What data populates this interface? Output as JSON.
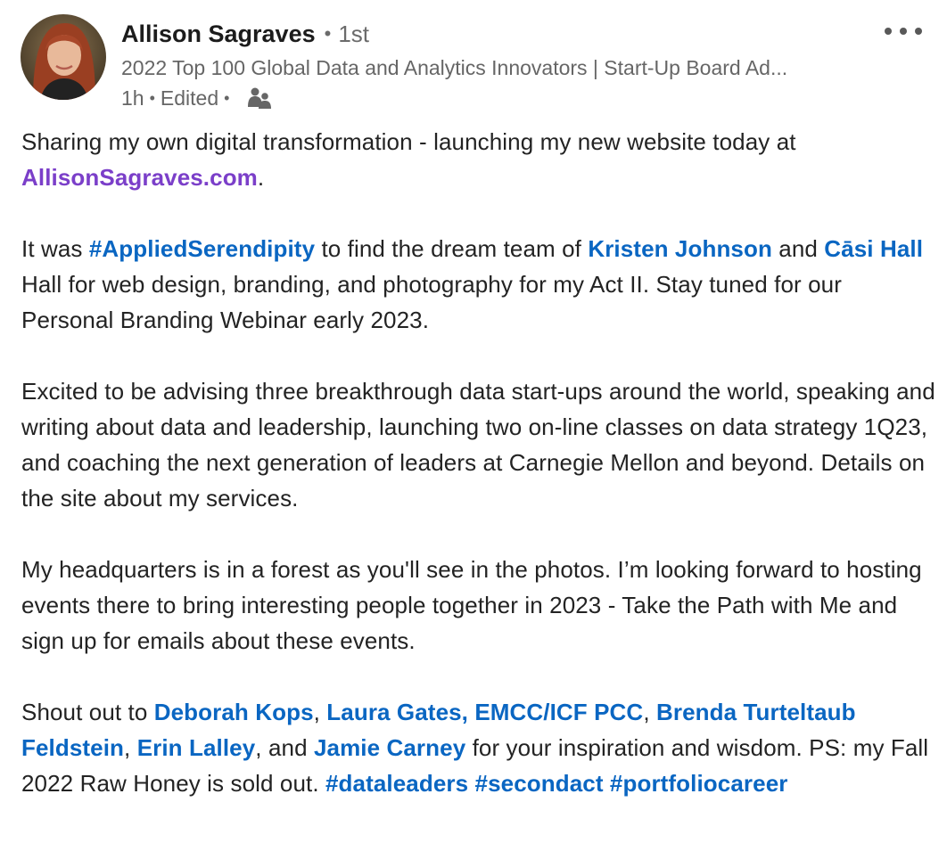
{
  "author": {
    "name": "Allison Sagraves",
    "bullet": "•",
    "degree": "1st",
    "headline": "2022 Top 100 Global Data and Analytics Innovators | Start-Up Board Ad...",
    "time": "1h",
    "separator": "•",
    "edited": "Edited",
    "visibility_icon": "connections-icon"
  },
  "post": {
    "p1_a": "Sharing my own digital transformation - launching my new website today at ",
    "p1_link": "AllisonSagraves.com",
    "p1_b": ".",
    "p2_a": "It was ",
    "p2_tag": "#AppliedSerendipity",
    "p2_b": " to find the dream team of ",
    "p2_m1": "Kristen Johnson",
    "p2_c": " and ",
    "p2_m2": "Cāsi Hall",
    "p2_d": " Hall for web design, branding, and photography for my Act II. Stay tuned for our Personal Branding Webinar early 2023.",
    "p3": "Excited to be advising three breakthrough data start-ups around the world, speaking and writing about data and leadership, launching two on-line classes on data strategy 1Q23, and coaching the next generation of leaders at Carnegie Mellon and beyond. Details on the site about my services.",
    "p4": "My headquarters is in a forest as you'll see in the photos. I’m looking forward to hosting events there to bring interesting people together in 2023 - Take the Path with Me and sign up for emails about these events.",
    "p5_a": "Shout out to ",
    "p5_m1": "Deborah Kops",
    "p5_sep1": ", ",
    "p5_m2": "Laura Gates, EMCC/ICF PCC",
    "p5_sep2": ", ",
    "p5_m3": "Brenda Turteltaub Feldstein",
    "p5_sep3": ", ",
    "p5_m4": "Erin Lalley",
    "p5_b": ", and ",
    "p5_m5": "Jamie Carney",
    "p5_c": " for your inspiration and wisdom. PS: my Fall 2022 Raw Honey is sold out. ",
    "p5_t1": "#dataleaders",
    "p5_d": " ",
    "p5_t2": "#secondact",
    "p5_e": " ",
    "p5_t3": "#portfoliocareer"
  },
  "colors": {
    "link": "#0a66c2",
    "visited_link": "#7b3fc9",
    "secondary_text": "#666666"
  }
}
